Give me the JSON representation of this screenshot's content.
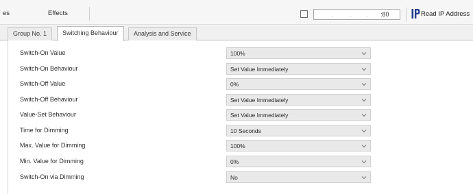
{
  "toolbar": {
    "left_fragment": "es",
    "effects_label": "Effects",
    "ip": {
      "placeholder_dots": [
        ".",
        ".",
        "."
      ],
      "port": ":80",
      "read_button_label": "Read IP Address",
      "icon": "ip-network-icon"
    }
  },
  "tabs": [
    {
      "label": "Group No. 1",
      "active": false
    },
    {
      "label": "Switching Behaviour",
      "active": true
    },
    {
      "label": "Analysis and Service",
      "active": false
    }
  ],
  "settings": [
    {
      "label": "Switch-On Value",
      "value": "100%"
    },
    {
      "label": "Switch-On Behaviour",
      "value": "Set Value Immediately"
    },
    {
      "label": "Switch-Off Value",
      "value": "0%"
    },
    {
      "label": "Switch-Off Behaviour",
      "value": "Set Value Immediately"
    },
    {
      "label": "Value-Set Behaviour",
      "value": "Set Value Immediately"
    },
    {
      "label": "Time for Dimming",
      "value": "10 Seconds"
    },
    {
      "label": "Max. Value for Dimming",
      "value": "100%"
    },
    {
      "label": "Min. Value for Dimming",
      "value": "0%"
    },
    {
      "label": "Switch-On via Dimming",
      "value": "No"
    }
  ],
  "colors": {
    "select_bg": "#e9e9e9",
    "active_tab_bg": "#ffffff",
    "icon_blue": "#1f3b8c"
  }
}
